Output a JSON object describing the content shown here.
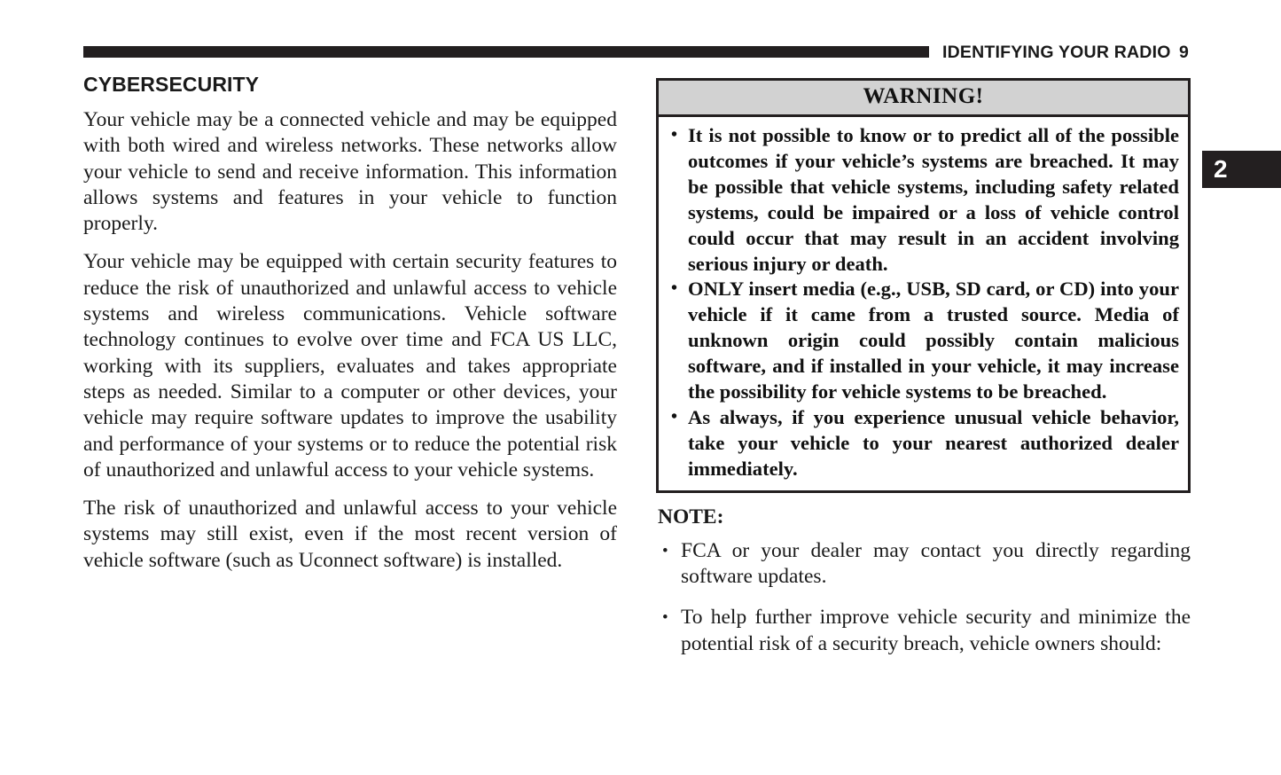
{
  "header": {
    "title": "IDENTIFYING YOUR RADIO",
    "page_number": "9",
    "rule_color": "#231f20"
  },
  "chapter_tab": {
    "number": "2",
    "background": "#231f20",
    "text_color": "#ffffff"
  },
  "left_column": {
    "heading": "CYBERSECURITY",
    "paragraphs": [
      "Your vehicle may be a connected vehicle and may be equipped with both wired and wireless networks. These networks allow your vehicle to send and receive information. This information allows systems and features in your vehicle to function properly.",
      "Your vehicle may be equipped with certain security features to reduce the risk of unauthorized and unlawful access to vehicle systems and wireless communications. Vehicle software technology continues to evolve over time and FCA US LLC, working with its suppliers, evaluates and takes appropriate steps as needed. Similar to a computer or other devices, your vehicle may require software updates to improve the usability and performance of your systems or to reduce the potential risk of unauthorized and unlawful access to your vehicle systems.",
      "The risk of unauthorized and unlawful access to your vehicle systems may still exist, even if the most recent version of vehicle software (such as Uconnect software) is installed."
    ]
  },
  "warning": {
    "title": "WARNING!",
    "header_background": "#d2d2d2",
    "border_color": "#231f20",
    "bullet_glyph": "•",
    "items": [
      "It is not possible to know or to predict all of the possible outcomes if your vehicle’s systems are breached. It may be possible that vehicle systems, including safety related systems, could be impaired or a loss of vehicle control could occur that may result in an accident involving serious injury or death.",
      "ONLY insert media (e.g., USB, SD card, or CD) into your vehicle if it came from a trusted source. Media of unknown origin could possibly contain malicious software, and if installed in your vehicle, it may increase the possibility for vehicle systems to be breached.",
      "As always, if you experience unusual vehicle behavior, take your vehicle to your nearest authorized dealer immediately."
    ]
  },
  "note": {
    "heading": "NOTE:",
    "bullet_glyph": "•",
    "items": [
      "FCA or your dealer may contact you directly regarding software updates.",
      "To help further improve vehicle security and minimize the potential risk of a security breach, vehicle owners should:"
    ]
  }
}
